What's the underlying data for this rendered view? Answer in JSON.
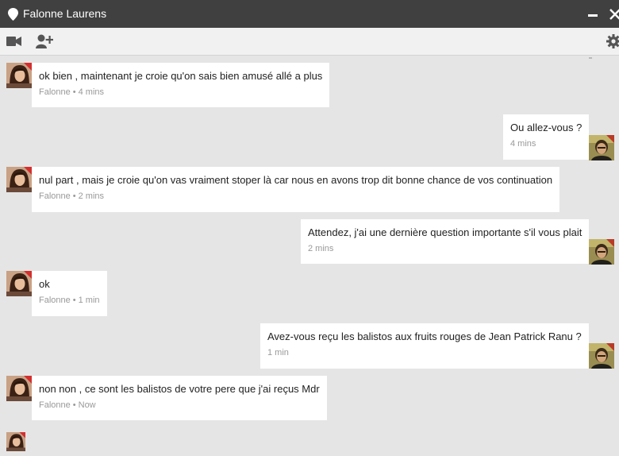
{
  "window": {
    "title": "Falonne Laurens"
  },
  "contact": {
    "name": "Falonne"
  },
  "colors": {
    "titlebar": "#404040",
    "toolbar": "#f1f1f1",
    "background": "#e5e5e5",
    "bubble": "#ffffff",
    "meta_text": "#999999",
    "avatar_accent": "#d32f2f"
  },
  "toolbar": {
    "icons": [
      "video-camera-icon",
      "add-person-icon",
      "settings-gear-icon"
    ]
  },
  "messages": [
    {
      "direction": "in",
      "text": "ok bien , maintenant je croie qu'on sais bien amusé allé a plus",
      "sender": "Falonne",
      "time": "4 mins"
    },
    {
      "direction": "out",
      "text": "Ou allez-vous ?",
      "time": "4 mins"
    },
    {
      "direction": "in",
      "text": "nul part , mais je croie qu'on vas vraiment stoper là car nous en avons trop dit bonne chance de vos continuation",
      "sender": "Falonne",
      "time": "2 mins"
    },
    {
      "direction": "out",
      "text": "Attendez, j'ai une dernière question importante s'il vous plait",
      "time": "2 mins"
    },
    {
      "direction": "in",
      "text": "ok",
      "sender": "Falonne",
      "time": "1 min"
    },
    {
      "direction": "out",
      "text": "Avez-vous reçu les balistos aux fruits rouges de Jean Patrick Ranu ?",
      "time": "1 min"
    },
    {
      "direction": "in",
      "text": "non non , ce sont les balistos de votre pere que j'ai reçus Mdr",
      "sender": "Falonne",
      "time": "Now"
    }
  ],
  "meta_separator": "•"
}
